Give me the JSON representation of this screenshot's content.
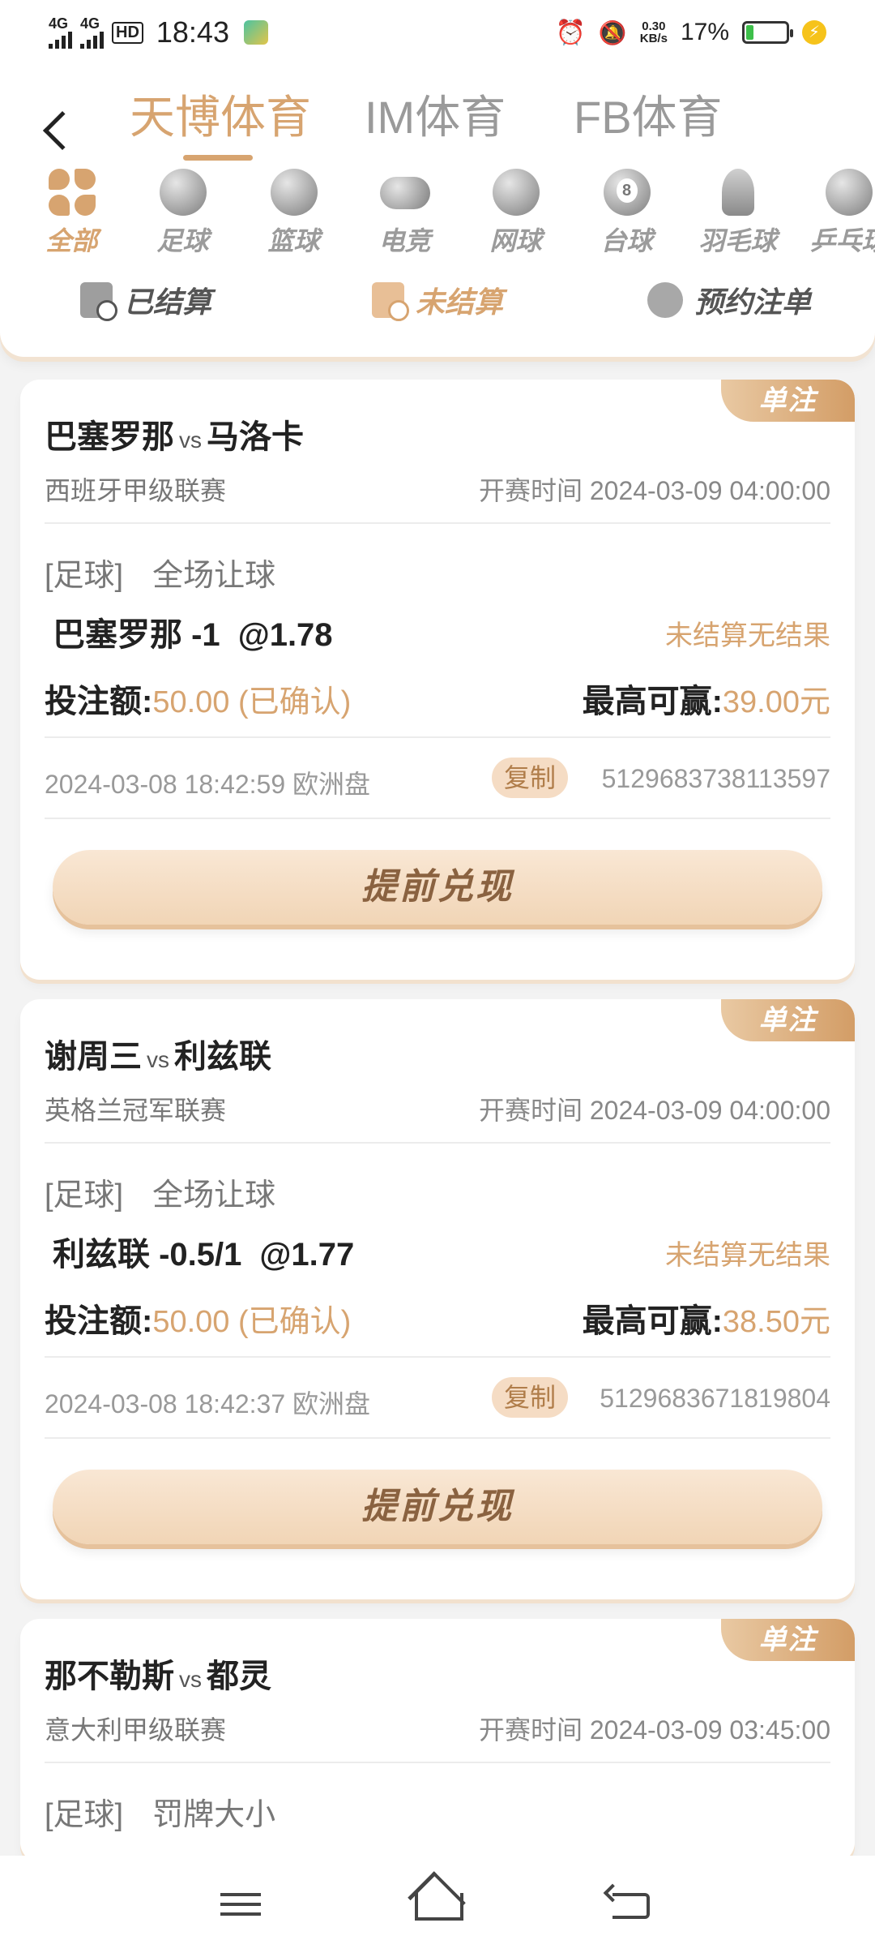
{
  "status_bar": {
    "net1": "4G",
    "net2": "4G",
    "hd": "HD",
    "time": "18:43",
    "speed_value": "0.30",
    "speed_unit": "KB/s",
    "battery_pct": "17%"
  },
  "header": {
    "platform_tabs": [
      {
        "label": "天博体育",
        "active": true
      },
      {
        "label": "IM体育",
        "active": false
      },
      {
        "label": "FB体育",
        "active": false
      }
    ],
    "sports": [
      {
        "label": "全部",
        "icon": "all-icon",
        "active": true
      },
      {
        "label": "足球",
        "icon": "football-icon"
      },
      {
        "label": "篮球",
        "icon": "basketball-icon"
      },
      {
        "label": "电竞",
        "icon": "esports-icon"
      },
      {
        "label": "网球",
        "icon": "tennis-icon"
      },
      {
        "label": "台球",
        "icon": "billiards-icon"
      },
      {
        "label": "羽毛球",
        "icon": "badminton-icon"
      },
      {
        "label": "乒乓球",
        "icon": "pingpong-icon"
      }
    ],
    "settle_tabs": [
      {
        "label": "已结算",
        "active": false
      },
      {
        "label": "未结算",
        "active": true
      },
      {
        "label": "预约注单",
        "active": false
      }
    ]
  },
  "labels": {
    "badge": "单注",
    "vs": "vs",
    "start_prefix": "开赛时间",
    "stake_label": "投注额:",
    "win_label": "最高可赢:",
    "copy": "复制",
    "cashout": "提前兑现"
  },
  "bets": [
    {
      "home": "巴塞罗那",
      "away": "马洛卡",
      "league": "西班牙甲级联赛",
      "start_time": "开赛时间 2024-03-09 04:00:00",
      "sport": "[足球]",
      "market": "全场让球",
      "pick": "巴塞罗那 -1",
      "odds": "@1.78",
      "result": "未结算无结果",
      "stake": "50.00 (已确认)",
      "max_win": "39.00元",
      "placed": "2024-03-08 18:42:59 欧洲盘",
      "order_no": "5129683738113597"
    },
    {
      "home": "谢周三",
      "away": "利兹联",
      "league": "英格兰冠军联赛",
      "start_time": "开赛时间 2024-03-09 04:00:00",
      "sport": "[足球]",
      "market": "全场让球",
      "pick": "利兹联 -0.5/1",
      "odds": "@1.77",
      "result": "未结算无结果",
      "stake": "50.00 (已确认)",
      "max_win": "38.50元",
      "placed": "2024-03-08 18:42:37 欧洲盘",
      "order_no": "5129683671819804"
    },
    {
      "home": "那不勒斯",
      "away": "都灵",
      "league": "意大利甲级联赛",
      "start_time": "开赛时间 2024-03-09 03:45:00",
      "sport": "[足球]",
      "market": "罚牌大小"
    }
  ]
}
